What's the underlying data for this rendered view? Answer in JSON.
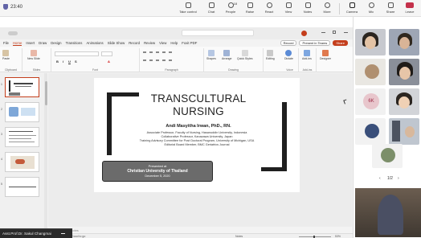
{
  "meeting": {
    "timer": "23:40",
    "tools": [
      {
        "label": "Take control",
        "icon": "take-control-icon"
      },
      {
        "label": "Chat",
        "icon": "chat-icon"
      },
      {
        "label": "People",
        "icon": "people-icon",
        "count": "18"
      },
      {
        "label": "Raise",
        "icon": "raise-hand-icon"
      },
      {
        "label": "React",
        "icon": "react-icon"
      },
      {
        "label": "View",
        "icon": "view-icon"
      },
      {
        "label": "Notes",
        "icon": "notes-icon"
      },
      {
        "label": "More",
        "icon": "more-icon"
      },
      {
        "label": "Camera",
        "icon": "camera-icon"
      },
      {
        "label": "Mic",
        "icon": "mic-icon"
      },
      {
        "label": "Share",
        "icon": "share-icon"
      },
      {
        "label": "Leave",
        "icon": "leave-icon"
      }
    ]
  },
  "powerpoint": {
    "menu_tabs": [
      "File",
      "Home",
      "Insert",
      "Draw",
      "Design",
      "Transitions",
      "Animations",
      "Slide Show",
      "Record",
      "Review",
      "View",
      "Help",
      "Foxit PDF"
    ],
    "active_tab": "Home",
    "record_btn": "Record",
    "present_btn": "Present in Teams",
    "share_btn": "Share",
    "ribbon_groups": [
      "Clipboard",
      "Slides",
      "Font",
      "Paragraph",
      "Drawing",
      "Voice",
      "Add-ins"
    ],
    "ribbon_buttons": {
      "paste": "Paste",
      "new_slide": "New Slide",
      "shapes": "Shapes",
      "arrange": "Arrange",
      "quick_styles": "Quick Styles",
      "editing": "Editing",
      "dictate": "Dictate",
      "addins": "Add-ins",
      "designer": "Designer"
    },
    "slide_numbers": [
      "1",
      "2",
      "3",
      "4",
      "5"
    ],
    "notes_placeholder": "Click to add notes",
    "status": {
      "slide": "Slide 1 of 36",
      "language": "English (United States)",
      "accessibility": "Accessibility: Good to go",
      "notes": "Notes",
      "zoom": "53%"
    }
  },
  "slide": {
    "title_line1": "TRANSCULTURAL",
    "title_line2": "NURSING",
    "author": "Andi Masyitha Irwan, PhD., RN.",
    "lines": [
      "Associate Professor, Faculty of Nursing, Hasanuddin University, Indonesia",
      "Collaborative Professor, Kanazawa University, Japan",
      "Training Advisory Committee for Post Doctoral Program, University of Michigan, USA",
      "Editorial Board Member, BMC Geriatrics Journal"
    ],
    "box": {
      "presented_at": "Presented at",
      "venue": "Christian University of Thailand",
      "date": "December 5, 2020"
    }
  },
  "taskbar": {
    "title": "Asst.Prof.Dr. Sakul Changmai"
  },
  "participants": {
    "initials_tile": "6K",
    "paging": "1/2"
  }
}
